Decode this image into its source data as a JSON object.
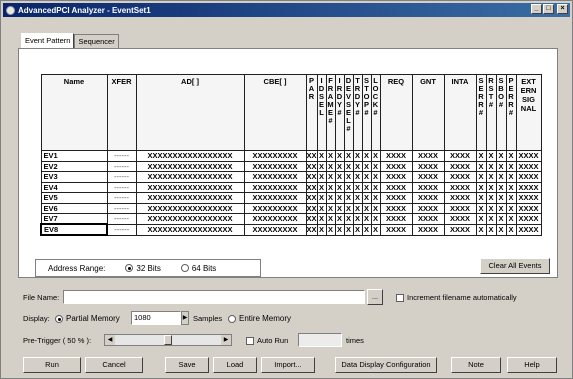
{
  "window": {
    "title": "AdvancedPCI Analyzer - EventSet1"
  },
  "tabs": [
    "Event Pattern",
    "Sequencer"
  ],
  "grid": {
    "headers": {
      "name": "Name",
      "xfer": "XFER",
      "ad": "AD[ ]",
      "cbe": "CBE[ ]",
      "par": "P A R",
      "idsel": "I D S E L",
      "frame": "F R A M E #",
      "irdy": "I R D Y #",
      "devsel": "D E V S E L #",
      "trdy": "T R D Y #",
      "stop": "S T O P #",
      "lock": "L O C K #",
      "req": "REQ",
      "gnt": "GNT",
      "inta": "INTA",
      "serr": "S E R R #",
      "rst": "R S T #",
      "sbo": "S B O #",
      "perr": "P E R R #",
      "ext": "EXT ERN SIG NAL"
    },
    "rows": [
      {
        "name": "EV1",
        "xfer": "------",
        "ad": "XXXXXXXXXXXXXXXXX",
        "cbe": "XXXXXXXXX",
        "par": "XX",
        "idsel": "X",
        "frame": "X",
        "irdy": "X",
        "devsel": "X",
        "trdy": "X",
        "stop": "X",
        "lock": "X",
        "req": "XXXX",
        "gnt": "XXXX",
        "inta": "XXXX",
        "serr": "X",
        "rst": "X",
        "sbo": "X",
        "perr": "X",
        "ext": "XXXX"
      },
      {
        "name": "EV2",
        "xfer": "------",
        "ad": "XXXXXXXXXXXXXXXXX",
        "cbe": "XXXXXXXXX",
        "par": "XX",
        "idsel": "X",
        "frame": "X",
        "irdy": "X",
        "devsel": "X",
        "trdy": "X",
        "stop": "X",
        "lock": "X",
        "req": "XXXX",
        "gnt": "XXXX",
        "inta": "XXXX",
        "serr": "X",
        "rst": "X",
        "sbo": "X",
        "perr": "X",
        "ext": "XXXX"
      },
      {
        "name": "EV3",
        "xfer": "------",
        "ad": "XXXXXXXXXXXXXXXXX",
        "cbe": "XXXXXXXXX",
        "par": "XX",
        "idsel": "X",
        "frame": "X",
        "irdy": "X",
        "devsel": "X",
        "trdy": "X",
        "stop": "X",
        "lock": "X",
        "req": "XXXX",
        "gnt": "XXXX",
        "inta": "XXXX",
        "serr": "X",
        "rst": "X",
        "sbo": "X",
        "perr": "X",
        "ext": "XXXX"
      },
      {
        "name": "EV4",
        "xfer": "------",
        "ad": "XXXXXXXXXXXXXXXXX",
        "cbe": "XXXXXXXXX",
        "par": "XX",
        "idsel": "X",
        "frame": "X",
        "irdy": "X",
        "devsel": "X",
        "trdy": "X",
        "stop": "X",
        "lock": "X",
        "req": "XXXX",
        "gnt": "XXXX",
        "inta": "XXXX",
        "serr": "X",
        "rst": "X",
        "sbo": "X",
        "perr": "X",
        "ext": "XXXX"
      },
      {
        "name": "EV5",
        "xfer": "------",
        "ad": "XXXXXXXXXXXXXXXXX",
        "cbe": "XXXXXXXXX",
        "par": "XX",
        "idsel": "X",
        "frame": "X",
        "irdy": "X",
        "devsel": "X",
        "trdy": "X",
        "stop": "X",
        "lock": "X",
        "req": "XXXX",
        "gnt": "XXXX",
        "inta": "XXXX",
        "serr": "X",
        "rst": "X",
        "sbo": "X",
        "perr": "X",
        "ext": "XXXX"
      },
      {
        "name": "EV6",
        "xfer": "------",
        "ad": "XXXXXXXXXXXXXXXXX",
        "cbe": "XXXXXXXXX",
        "par": "XX",
        "idsel": "X",
        "frame": "X",
        "irdy": "X",
        "devsel": "X",
        "trdy": "X",
        "stop": "X",
        "lock": "X",
        "req": "XXXX",
        "gnt": "XXXX",
        "inta": "XXXX",
        "serr": "X",
        "rst": "X",
        "sbo": "X",
        "perr": "X",
        "ext": "XXXX"
      },
      {
        "name": "EV7",
        "xfer": "------",
        "ad": "XXXXXXXXXXXXXXXXX",
        "cbe": "XXXXXXXXX",
        "par": "XX",
        "idsel": "X",
        "frame": "X",
        "irdy": "X",
        "devsel": "X",
        "trdy": "X",
        "stop": "X",
        "lock": "X",
        "req": "XXXX",
        "gnt": "XXXX",
        "inta": "XXXX",
        "serr": "X",
        "rst": "X",
        "sbo": "X",
        "perr": "X",
        "ext": "XXXX"
      },
      {
        "name": "EV8",
        "xfer": "------",
        "ad": "XXXXXXXXXXXXXXXXX",
        "cbe": "XXXXXXXXX",
        "par": "XX",
        "idsel": "X",
        "frame": "X",
        "irdy": "X",
        "devsel": "X",
        "trdy": "X",
        "stop": "X",
        "lock": "X",
        "req": "XXXX",
        "gnt": "XXXX",
        "inta": "XXXX",
        "serr": "X",
        "rst": "X",
        "sbo": "X",
        "perr": "X",
        "ext": "XXXX"
      }
    ]
  },
  "address_range": {
    "label": "Address Range:",
    "option_32": "32 Bits",
    "option_64": "64 Bits",
    "selected": "32 Bits"
  },
  "clear_all_label": "Clear All Events",
  "file": {
    "label": "File Name:",
    "value": "",
    "browse_label": "...",
    "increment_label": "Increment filename automatically"
  },
  "display": {
    "label": "Display:",
    "partial_label": "Partial Memory",
    "samples_value": "1080",
    "samples_label": "Samples",
    "entire_label": "Entire Memory"
  },
  "pretrigger": {
    "label": "Pre-Trigger ( 50 % ):",
    "percent": 50,
    "autorun_label": "Auto Run",
    "autorun_value": "",
    "times_label": "times"
  },
  "buttons": {
    "run": "Run",
    "cancel": "Cancel",
    "save": "Save",
    "load": "Load",
    "import": "Import...",
    "data_display": "Data Display Configuration",
    "note": "Note",
    "help": "Help"
  }
}
